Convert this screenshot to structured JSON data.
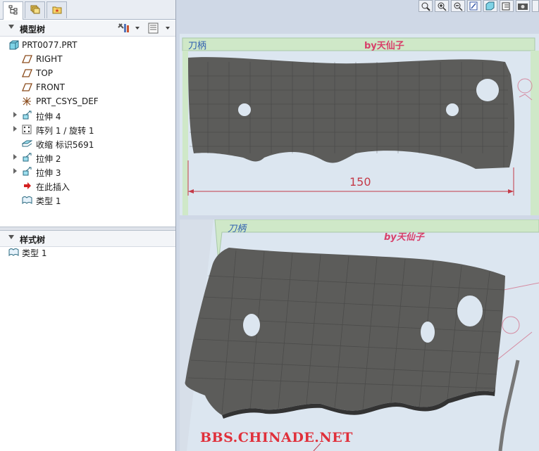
{
  "model_tree": {
    "title": "模型树",
    "items": [
      {
        "label": "PRT0077.PRT",
        "icon": "part-icon",
        "expandable": false
      },
      {
        "label": "RIGHT",
        "icon": "datum-plane-icon",
        "expandable": false
      },
      {
        "label": "TOP",
        "icon": "datum-plane-icon",
        "expandable": false
      },
      {
        "label": "FRONT",
        "icon": "datum-plane-icon",
        "expandable": false
      },
      {
        "label": "PRT_CSYS_DEF",
        "icon": "coordinate-system-icon",
        "expandable": false
      },
      {
        "label": "拉伸 4",
        "icon": "extrude-icon",
        "expandable": true
      },
      {
        "label": "阵列 1 / 旋转 1",
        "icon": "pattern-icon",
        "expandable": true
      },
      {
        "label": "收缩 标识5691",
        "icon": "shrink-icon",
        "expandable": false
      },
      {
        "label": "拉伸 2",
        "icon": "extrude-icon",
        "expandable": true
      },
      {
        "label": "拉伸 3",
        "icon": "extrude-icon",
        "expandable": true
      },
      {
        "label": "在此插入",
        "icon": "insert-here-arrow-icon",
        "expandable": false
      },
      {
        "label": "类型 1",
        "icon": "style-type-icon",
        "expandable": false
      }
    ]
  },
  "style_tree": {
    "title": "样式树",
    "items": [
      {
        "label": "类型 1",
        "icon": "style-type-icon"
      }
    ]
  },
  "viewport": {
    "sheet_title": "刀柄",
    "sheet_author": "by天仙子",
    "dimension": "150",
    "watermark": "BBS.CHINADE.NET"
  },
  "colors": {
    "part_surface": "#5c5c5a",
    "sheet_green": "#cfe8c8",
    "sheet_red": "#d8406a",
    "sheet_blue": "#2f5fb0"
  }
}
